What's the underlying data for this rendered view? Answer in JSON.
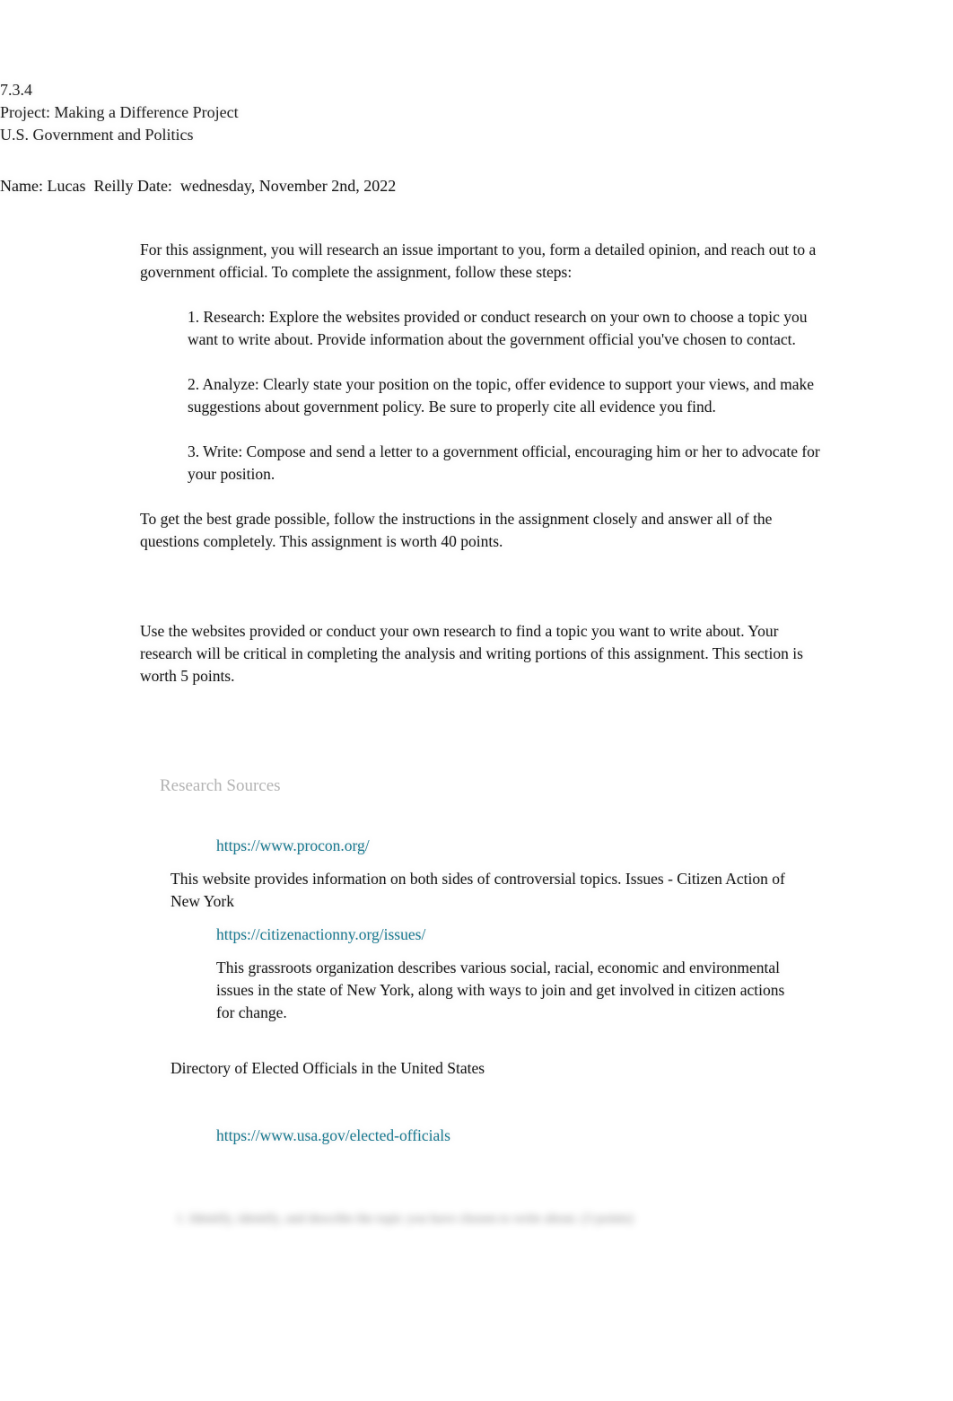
{
  "document": {
    "unit_number": "7.3.4",
    "project_title": "Project: Making a Difference Project",
    "course": "U.S. Government and Politics",
    "name_date_line": "Name: Lucas  Reilly Date:  wednesday, November 2nd, 2022"
  },
  "intro": {
    "paragraph": "For this assignment, you will research an issue important to you, form a detailed opinion, and reach out to a government official. To complete the assignment, follow these steps:"
  },
  "steps": [
    "1. Research: Explore the websites provided or conduct research on your own to choose a topic you want to write about. Provide information about the government official you've chosen to contact.",
    "2. Analyze: Clearly state your position on the topic, offer evidence to support your views, and make suggestions about government policy. Be sure to properly cite all evidence you find.",
    " 3. Write: Compose and send a letter to a government official, encouraging him or her to advocate for your position."
  ],
  "grading": {
    "paragraph": "To get the best grade possible, follow the instructions in the assignment closely and answer all of the questions completely. This assignment is worth 40 points."
  },
  "section_research": {
    "paragraph": "Use the websites provided or conduct your own research to find a topic you want to write about. Your research will be critical in completing the analysis and writing portions of this assignment. This section is worth 5 points.",
    "heading": "Research Sources",
    "sources": [
      {
        "url": "https://www.procon.org/",
        "description": "This website provides information on both sides of controversial topics. Issues - Citizen Action of New York"
      },
      {
        "url": "https://citizenactionny.org/issues/",
        "description": "This grassroots organization describes various social, racial, economic and environmental issues in the state of New York, along with ways to join and get involved in citizen actions for change."
      },
      {
        "title": "Directory of Elected Officials in the United States",
        "url": "https://www.usa.gov/elected-officials"
      }
    ]
  },
  "footer": {
    "blurred_question": "1. Identify, identify, and describe the topic you have chosen to write about. (3 points)"
  },
  "colors": {
    "link": "#18788f",
    "heading_muted": "#b3b3b3",
    "text": "#141414",
    "page_background": "#ffffff"
  }
}
